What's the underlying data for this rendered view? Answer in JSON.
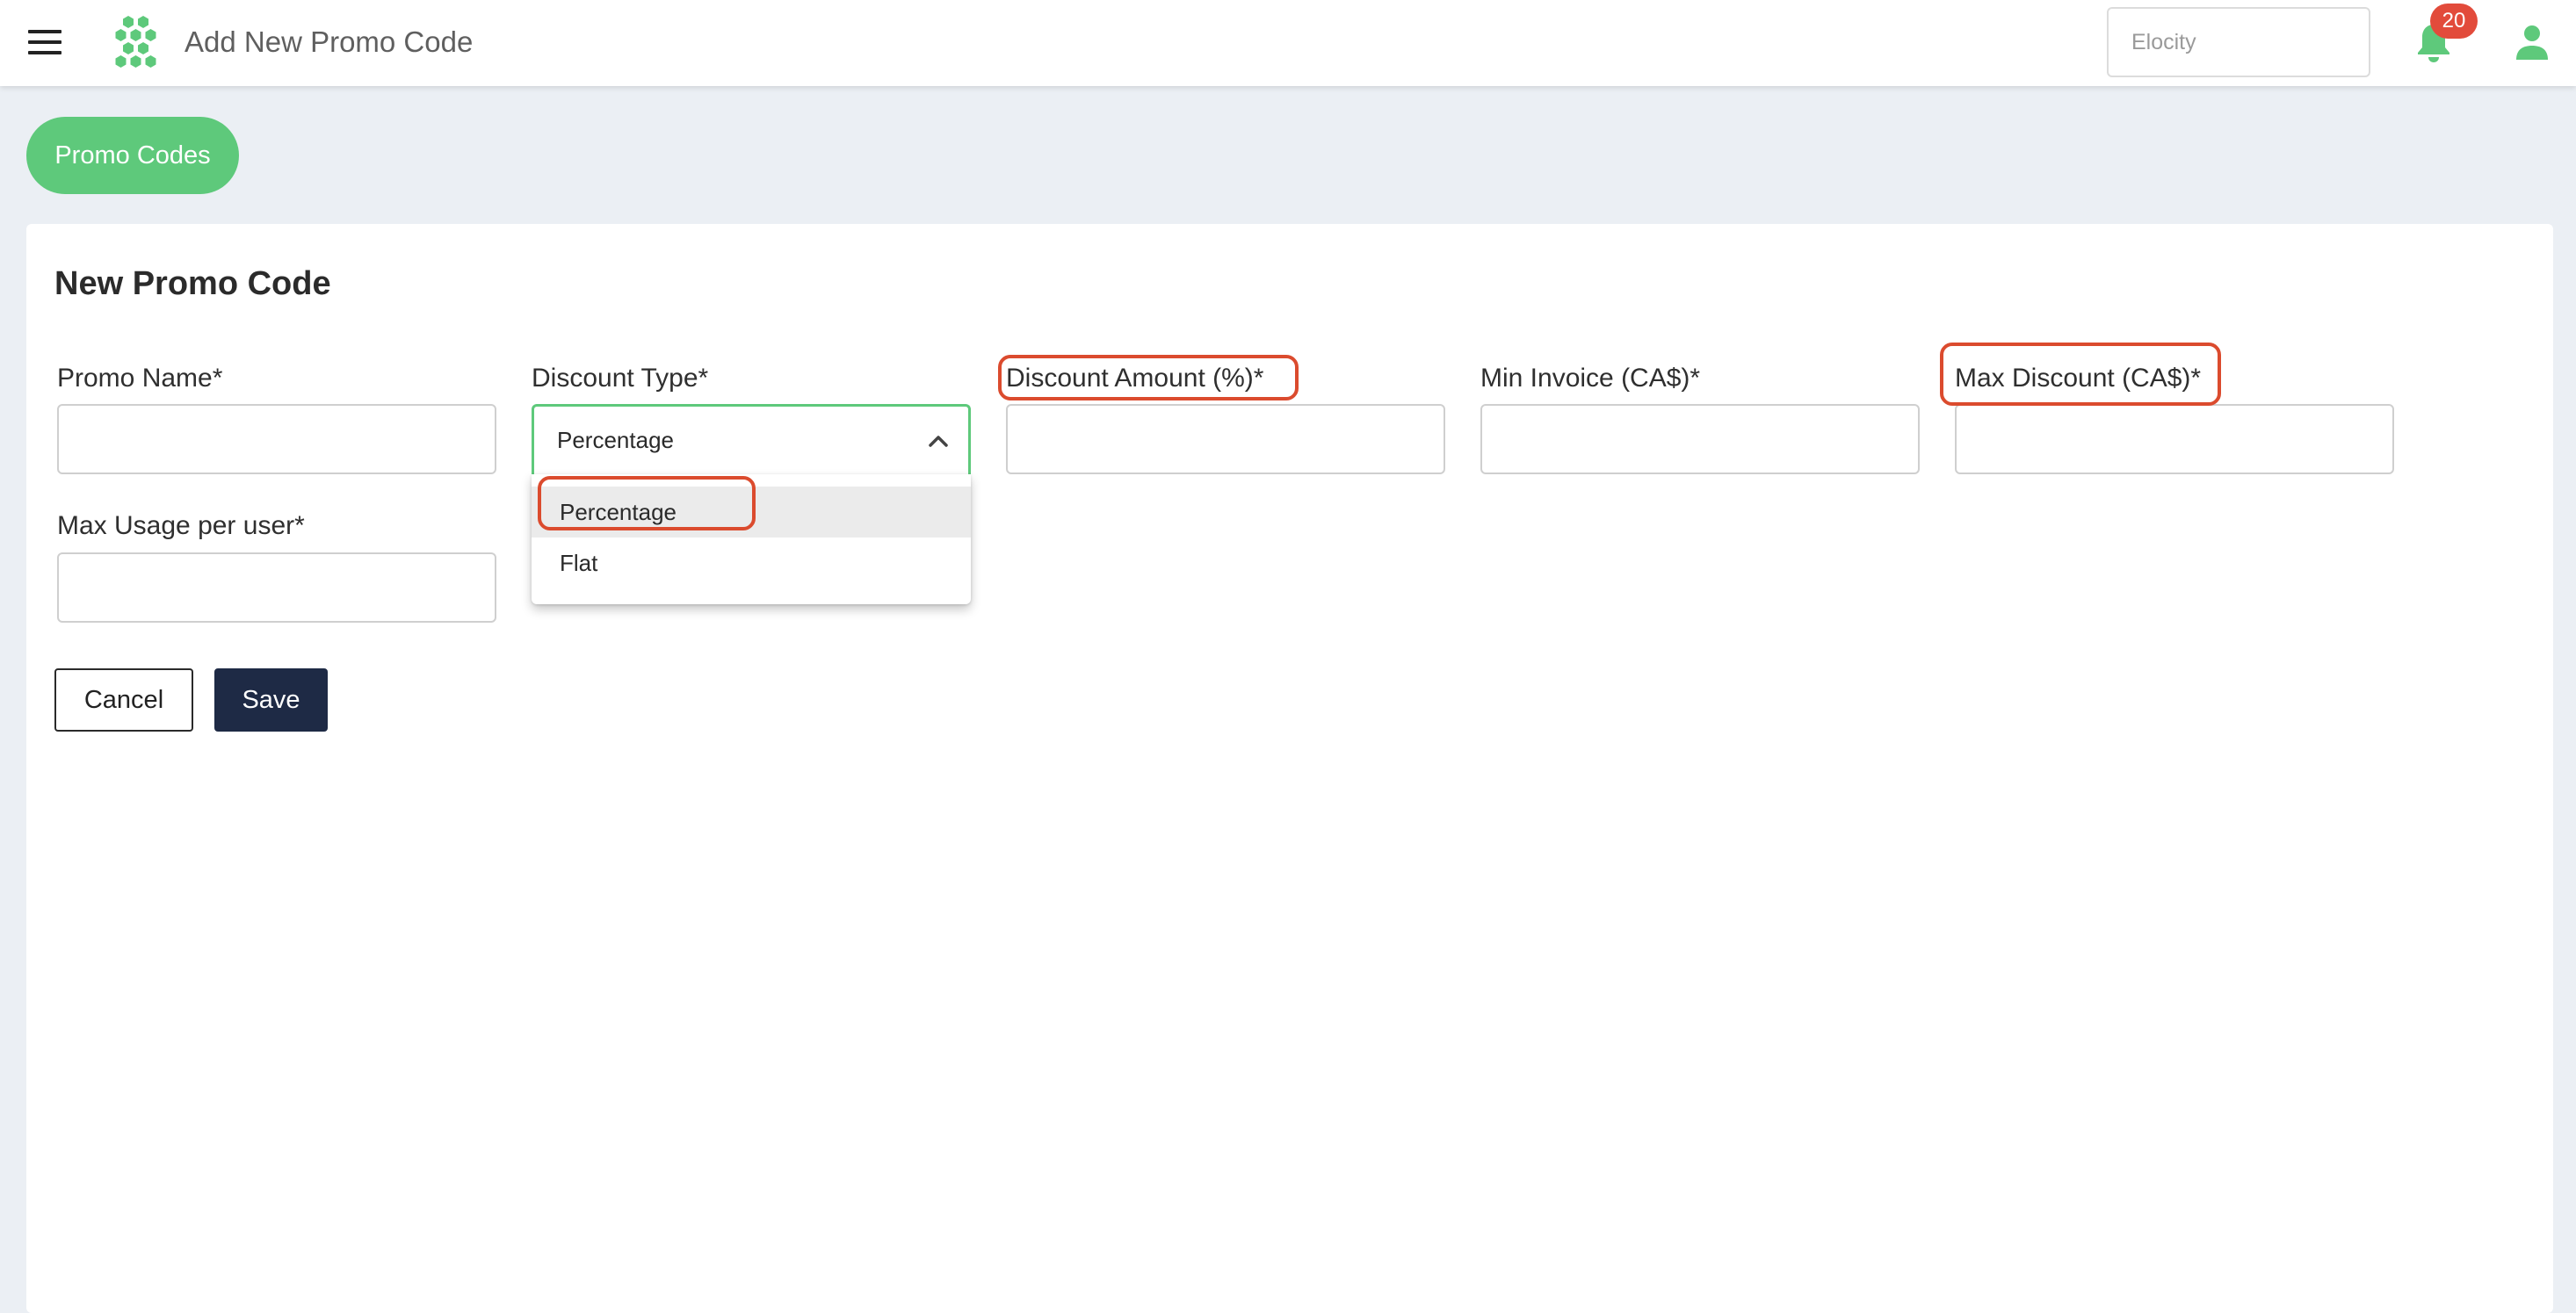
{
  "header": {
    "title": "Add New Promo Code",
    "org_placeholder": "Elocity",
    "notification_count": "20",
    "brand_color": "#5ec97b"
  },
  "nav": {
    "promo_codes_label": "Promo Codes"
  },
  "form": {
    "title": "New Promo Code",
    "fields": {
      "promo_name": {
        "label": "Promo Name*",
        "value": ""
      },
      "discount_type": {
        "label": "Discount Type*",
        "value": "Percentage"
      },
      "discount_amount": {
        "label": "Discount Amount (%)*",
        "value": ""
      },
      "min_invoice": {
        "label": "Min Invoice (CA$)*",
        "value": ""
      },
      "max_discount": {
        "label": "Max Discount (CA$)*",
        "value": ""
      },
      "max_usage": {
        "label": "Max Usage per user*",
        "value": ""
      }
    },
    "discount_type_options": [
      "Percentage",
      "Flat"
    ],
    "cancel_label": "Cancel",
    "save_label": "Save"
  },
  "annotations": {
    "highlight_color": "#db4b2e"
  }
}
